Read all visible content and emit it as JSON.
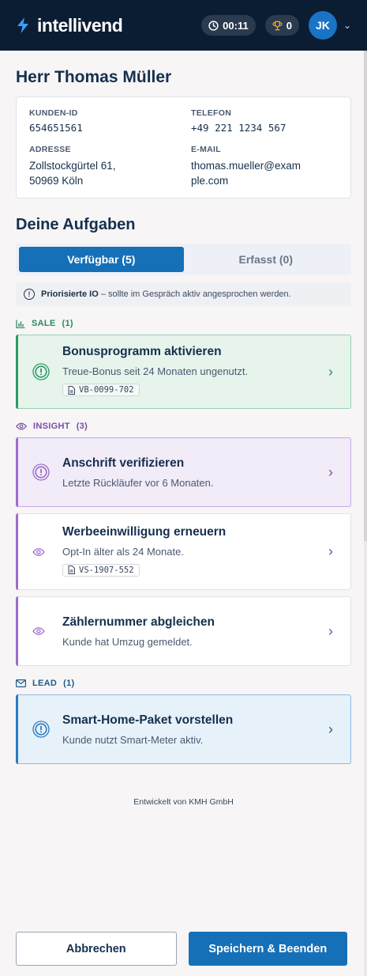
{
  "app": {
    "brand": "intellivend",
    "timer": "00:11",
    "trophy_count": "0",
    "user_initials": "JK"
  },
  "customer": {
    "name": "Herr Thomas Müller",
    "id_label": "KUNDEN-ID",
    "id_value": "654651561",
    "phone_label": "TELEFON",
    "phone_value": "+49 221 1234 567",
    "address_label": "ADRESSE",
    "address_line1": "Zollstockgürtel 61,",
    "address_line2": "50969 Köln",
    "email_label": "E-MAIL",
    "email_line1": "thomas.mueller@exam",
    "email_line2": "ple.com"
  },
  "tasks_section": {
    "title": "Deine Aufgaben",
    "tab_available": "Verfügbar (5)",
    "tab_captured": "Erfasst (0)",
    "notice_bold": "Priorisierte IO",
    "notice_rest": " – sollte im Gespräch aktiv angesprochen werden."
  },
  "groups": {
    "sale": "SALE",
    "sale_count": "(1)",
    "insight": "INSIGHT",
    "insight_count": "(3)",
    "lead": "LEAD",
    "lead_count": "(1)"
  },
  "tasks": [
    {
      "title": "Bonusprogramm aktivieren",
      "subtitle": "Treue-Bonus seit 24 Monaten ungenutzt.",
      "ref": "VB-0099-702"
    },
    {
      "title": "Anschrift verifizieren",
      "subtitle": "Letzte Rückläufer vor 6 Monaten."
    },
    {
      "title": "Werbeeinwilligung erneuern",
      "subtitle": "Opt-In älter als 24 Monate.",
      "ref": "VS-1907-552"
    },
    {
      "title": "Zählernummer abgleichen",
      "subtitle": "Kunde hat Umzug gemeldet."
    },
    {
      "title": "Smart-Home-Paket vorstellen",
      "subtitle": "Kunde nutzt Smart-Meter aktiv."
    }
  ],
  "footer": {
    "note": "Entwickelt von KMH GmbH",
    "cancel": "Abbrechen",
    "save": "Speichern & Beenden"
  },
  "colors": {
    "topbar": "#0b1d33",
    "primary": "#1670b8",
    "sale": "#2a9a64",
    "insight": "#9c6ccf",
    "lead": "#2b7ac2"
  }
}
